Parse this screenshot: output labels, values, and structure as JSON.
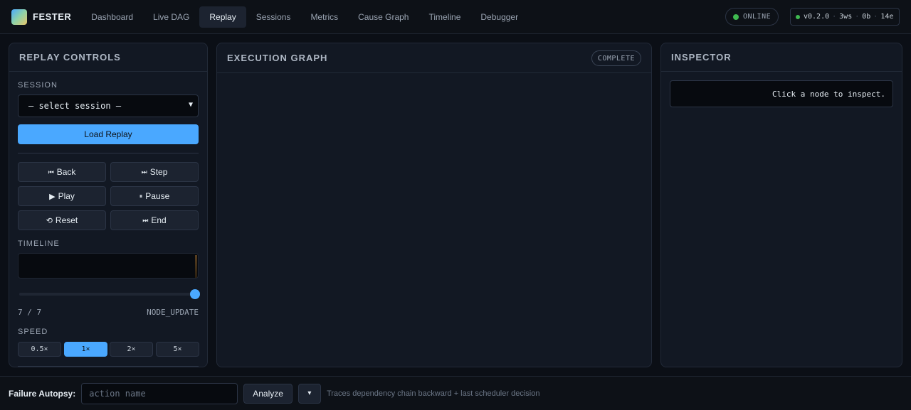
{
  "app": {
    "brand": "FESTER"
  },
  "nav": {
    "items": [
      {
        "label": "Dashboard"
      },
      {
        "label": "Live DAG"
      },
      {
        "label": "Replay"
      },
      {
        "label": "Sessions"
      },
      {
        "label": "Metrics"
      },
      {
        "label": "Cause Graph"
      },
      {
        "label": "Timeline"
      },
      {
        "label": "Debugger"
      }
    ],
    "active": "Replay"
  },
  "status": {
    "label": "ONLINE",
    "color": "#3fb950"
  },
  "stats": {
    "version": "v0.2.0",
    "ws": "3ws",
    "bytes": "0b",
    "events": "14e"
  },
  "replay_controls": {
    "title": "REPLAY CONTROLS",
    "session_label": "SESSION",
    "session_value": "— select session —",
    "load_label": "Load Replay",
    "buttons": {
      "back": "Back",
      "step": "Step",
      "play": "Play",
      "pause": "Pause",
      "reset": "Reset",
      "end": "End"
    },
    "timeline_label": "TIMELINE",
    "position": "7 / 7",
    "position_progress": 1.0,
    "event_type": "NODE_UPDATE",
    "speed_label": "SPEED",
    "speeds": [
      "0.5×",
      "1×",
      "2×",
      "5×"
    ],
    "active_speed": "1×"
  },
  "execution_graph": {
    "title": "EXECUTION GRAPH",
    "badge": "COMPLETE"
  },
  "inspector": {
    "title": "INSPECTOR",
    "placeholder": "Click a node to inspect."
  },
  "autopsy": {
    "label": "Failure Autopsy:",
    "input_placeholder": "action name",
    "analyze_label": "Analyze",
    "dropdown_icon": "▾",
    "hint": "Traces dependency chain backward + last scheduler decision"
  },
  "colors": {
    "accent": "#4aa8ff",
    "online": "#3fb950"
  }
}
